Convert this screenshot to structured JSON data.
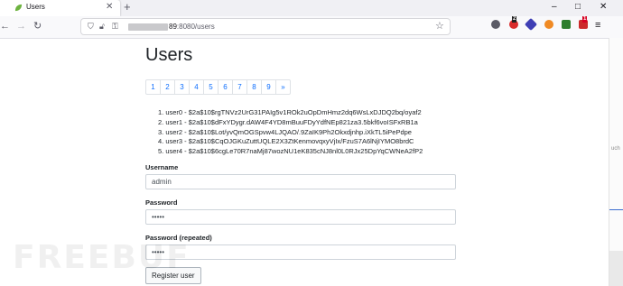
{
  "browser": {
    "tab_title": "Users",
    "url_host_suffix": "89",
    "url_rest": ":8080/users",
    "ext_badges": [
      "2",
      "1"
    ],
    "window_controls": [
      "–",
      "□",
      "✕"
    ]
  },
  "page": {
    "title": "Users",
    "pagination": [
      "1",
      "2",
      "3",
      "4",
      "5",
      "6",
      "7",
      "8",
      "9",
      "»"
    ],
    "users": [
      "1. user0 - $2a$10$rgTNVz2UrG31PAIg5v1ROk2uOpDmHmz2dq6WsLxDJDQ2bq/oyaf2",
      "2. user1 - $2a$10$dFxYDygr.dAW4F4YD8mBuuFDyYdfNEp821za3.5bkf6voISFxRB1a",
      "3. user2 - $2a$10$Lot/yvQmOGSpvw4LJQAO/.9ZaIK9Ph2Okxdjnhp.iXkTL5iPePdpe",
      "4. user3 - $2a$10$CqOJGKuZuttUQLE2X3ZtKenmovqxyVjIx/FzuS7A6lNjIYMO8brdC",
      "5. user4 - $2a$10$6cgLe70R7naMj87wozNU1eK835cNJ8nl0L0RJx25DpYqCWNeA2fP2"
    ],
    "form": {
      "username_label": "Username",
      "username_value": "admin",
      "password_label": "Password",
      "password_value": "•••••",
      "password2_label": "Password (repeated)",
      "password2_value": "•••••",
      "submit_label": "Register user"
    }
  },
  "side": {
    "fragment": "uch"
  },
  "watermark": "FREEBUF",
  "colors": {
    "link": "#0d6efd",
    "tabbar_bg": "#f0f0f4",
    "toolbar_bg": "#f9f9fb"
  }
}
